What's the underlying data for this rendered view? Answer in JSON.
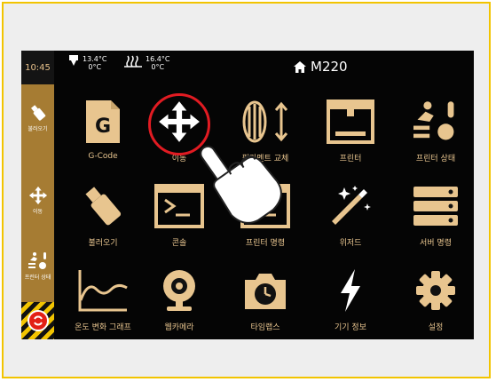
{
  "header": {
    "title": "M220",
    "time": "10:45",
    "nozzle": {
      "current": "13.4°C",
      "target": "0°C"
    },
    "bed": {
      "current": "16.4°C",
      "target": "0°C"
    }
  },
  "sidebar": {
    "items": [
      {
        "label": "불러오기",
        "icon": "usb-icon"
      },
      {
        "label": "이동",
        "icon": "move-arrows-icon"
      },
      {
        "label": "프린터 상태",
        "icon": "printer-status-icon"
      }
    ],
    "emergency_stop_icon": "emergency-stop-icon"
  },
  "grid": {
    "tiles": [
      {
        "label": "G-Code",
        "icon": "gcode-file-icon",
        "icon_text": "G"
      },
      {
        "label": "이동",
        "icon": "move-arrows-icon"
      },
      {
        "label": "필라멘트 교체",
        "icon": "filament-change-icon"
      },
      {
        "label": "프린터",
        "icon": "printer-icon"
      },
      {
        "label": "프린터 상태",
        "icon": "printer-status-icon"
      },
      {
        "label": "불러오기",
        "icon": "usb-icon"
      },
      {
        "label": "콘솔",
        "icon": "console-icon"
      },
      {
        "label": "프린터 명령",
        "icon": "printer-command-icon"
      },
      {
        "label": "위저드",
        "icon": "wizard-wand-icon"
      },
      {
        "label": "서버 명령",
        "icon": "server-icon"
      },
      {
        "label": "온도 변화 그래프",
        "icon": "temperature-graph-icon"
      },
      {
        "label": "웹카메라",
        "icon": "webcam-icon"
      },
      {
        "label": "타임랩스",
        "icon": "timelapse-camera-icon"
      },
      {
        "label": "기기 정보",
        "icon": "lightning-icon"
      },
      {
        "label": "설정",
        "icon": "settings-gear-icon"
      }
    ]
  },
  "colors": {
    "accent": "#e8c58f",
    "sidebar": "#a67c33",
    "highlight": "#e11b22",
    "frame": "#f2c400"
  }
}
